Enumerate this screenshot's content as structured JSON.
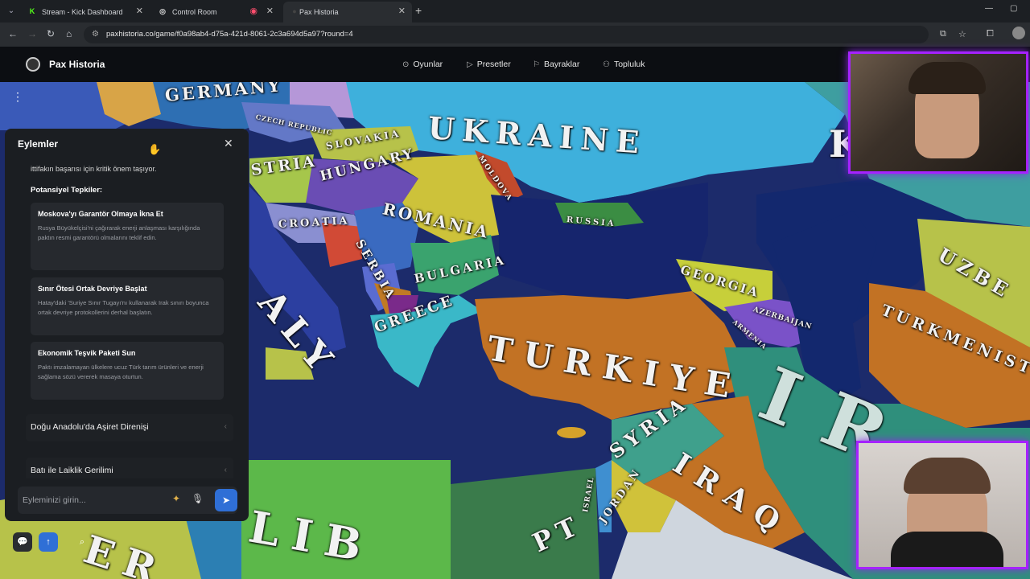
{
  "browser": {
    "tabs": [
      {
        "title": "Stream - Kick Dashboard",
        "favicon": "K",
        "fav_color": "#53fc18"
      },
      {
        "title": "Control Room",
        "favicon": "◎",
        "fav_color": "#dddddd"
      },
      {
        "title": "Pax Historia",
        "favicon": "●",
        "fav_color": "#444444"
      }
    ],
    "url": "paxhistoria.co/game/f0a98ab4-d75a-421d-8061-2c3a694d5a97?round=4"
  },
  "site": {
    "logo": "Pax Historia",
    "nav": [
      {
        "label": "Oyunlar",
        "icon": "gamepad-icon"
      },
      {
        "label": "Presetler",
        "icon": "play-icon"
      },
      {
        "label": "Bayraklar",
        "icon": "flag-icon"
      },
      {
        "label": "Topluluk",
        "icon": "users-icon"
      }
    ]
  },
  "panel": {
    "title": "Eylemler",
    "intro_text": "ittifakın başarısı için kritik önem taşıyor.",
    "section_title": "Potansiyel Tepkiler:",
    "actions": [
      {
        "title": "Moskova'yı Garantör Olmaya İkna Et",
        "desc": "Rusya Büyükelçisi'ni çağırarak enerji anlaşması karşılığında paktın resmi garantörü olmalarını teklif edin."
      },
      {
        "title": "Sınır Ötesi Ortak Devriye Başlat",
        "desc": "Hatay'daki 'Suriye Sınır Tugayı'nı kullanarak Irak sınırı boyunca ortak devriye protokollerini derhal başlatın."
      },
      {
        "title": "Ekonomik Teşvik Paketi Sun",
        "desc": "Paktı imzalamayan ülkelere ucuz Türk tarım ürünleri ve enerji sağlama sözü vererek masaya oturtun."
      }
    ],
    "collapsed": [
      {
        "label": "Doğu Anadolu'da Aşiret Direnişi"
      },
      {
        "label": "Batı ile Laiklik Gerilimi"
      }
    ],
    "input_placeholder": "Eyleminizi girin..."
  },
  "map": {
    "labels": [
      {
        "text": "GERMANY"
      },
      {
        "text": "CZECH REPUBLIC"
      },
      {
        "text": "UKRAINE"
      },
      {
        "text": "SLOVAKIA"
      },
      {
        "text": "HUNGARY"
      },
      {
        "text": "MOLDOVA"
      },
      {
        "text": "ROMANIA"
      },
      {
        "text": "RUSSIA"
      },
      {
        "text": "STRIA"
      },
      {
        "text": "CROATIA"
      },
      {
        "text": "SERBIA"
      },
      {
        "text": "BULGARIA"
      },
      {
        "text": "ALY"
      },
      {
        "text": "GREECE"
      },
      {
        "text": "TURKIYE"
      },
      {
        "text": "GEORGIA"
      },
      {
        "text": "AZERBAIJAN"
      },
      {
        "text": "ARMENIA"
      },
      {
        "text": "UZBE"
      },
      {
        "text": "TURKMENIST"
      },
      {
        "text": "IR"
      },
      {
        "text": "SYRIA"
      },
      {
        "text": "IRAQ"
      },
      {
        "text": "JORDAN"
      },
      {
        "text": "ISRAEL"
      },
      {
        "text": "PT"
      },
      {
        "text": "LIB"
      },
      {
        "text": "ER"
      },
      {
        "text": "K"
      }
    ]
  }
}
